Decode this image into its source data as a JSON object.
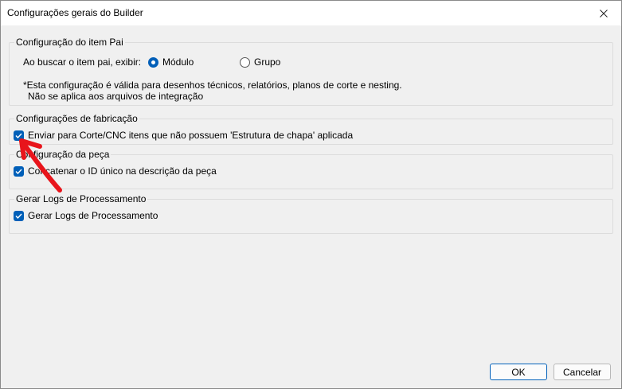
{
  "window": {
    "title": "Configurações gerais do Builder",
    "close_icon": "close-icon"
  },
  "parent_group": {
    "legend": "Configuração do item Pai",
    "search_label": "Ao buscar o item pai, exibir:",
    "options": [
      {
        "label": "Módulo",
        "checked": true
      },
      {
        "label": "Grupo",
        "checked": false
      }
    ],
    "note_line1": "*Esta configuração é válida para desenhos técnicos, relatórios, planos de corte e nesting.",
    "note_line2": "Não se aplica aos arquivos de integração"
  },
  "fabrication_group": {
    "legend": "Configurações de fabricação",
    "checkbox_label": "Enviar para Corte/CNC itens que não possuem 'Estrutura de chapa' aplicada",
    "checked": true
  },
  "piece_group": {
    "legend": "Configuração da peça",
    "checkbox_label": "Concatenar o ID único na descrição da peça",
    "checked": true
  },
  "logs_group": {
    "legend": "Gerar Logs de Processamento",
    "checkbox_label": "Gerar Logs de Processamento",
    "checked": true
  },
  "footer": {
    "ok_label": "OK",
    "cancel_label": "Cancelar"
  },
  "colors": {
    "accent": "#005fb8",
    "annotation_arrow": "#e8141b"
  }
}
